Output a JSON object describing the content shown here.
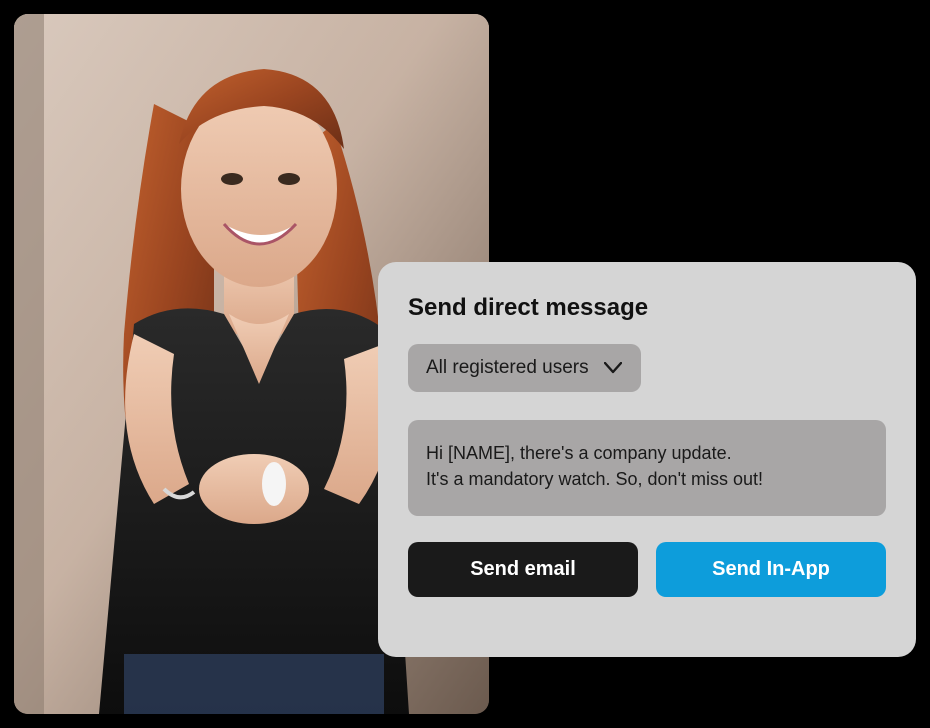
{
  "panel": {
    "title": "Send direct message",
    "dropdown": {
      "label": "All registered users"
    },
    "message": "Hi [NAME], there's a company update.\nIt's a mandatory watch. So, don't miss out!",
    "buttons": {
      "email": "Send email",
      "inapp": "Send In-App"
    }
  }
}
